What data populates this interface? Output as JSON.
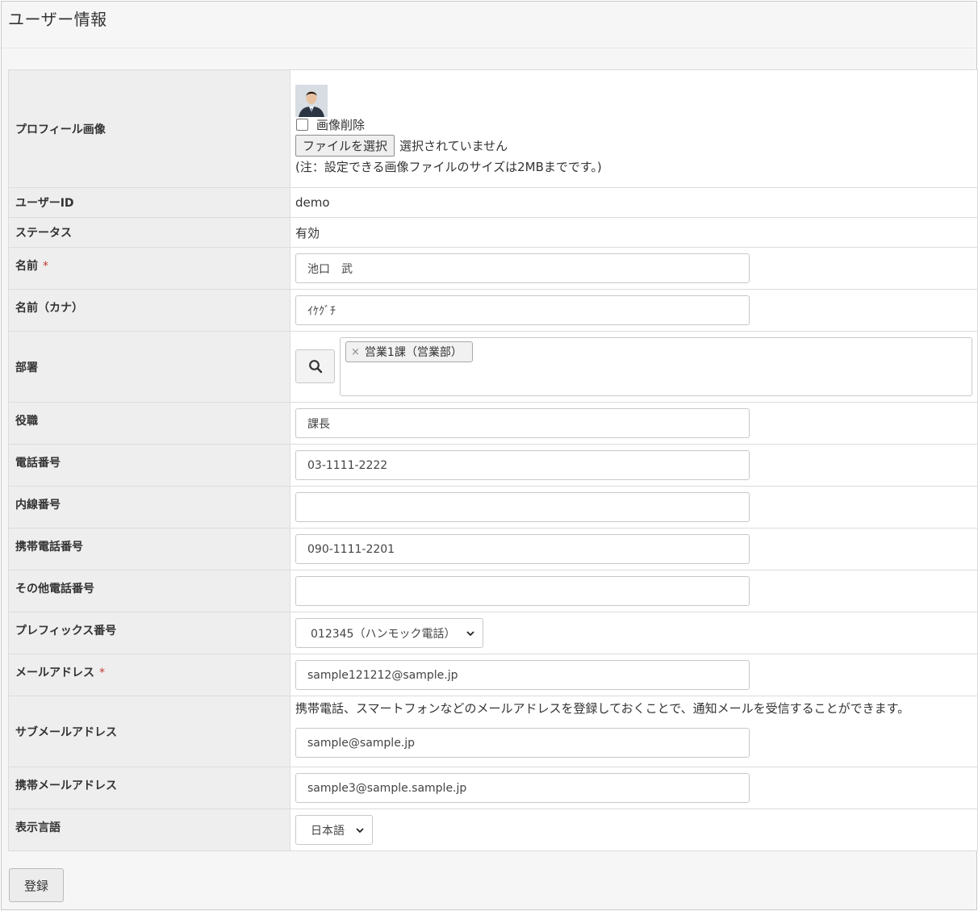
{
  "page": {
    "title": "ユーザー情報"
  },
  "profile": {
    "label": "プロフィール画像",
    "delete_label": "画像削除",
    "file_button": "ファイルを選択",
    "file_status": "選択されていません",
    "note": "(注：設定できる画像ファイルのサイズは2MBまでです。)"
  },
  "user_id": {
    "label": "ユーザーID",
    "value": "demo"
  },
  "status": {
    "label": "ステータス",
    "value": "有効"
  },
  "name": {
    "label": "名前",
    "required_mark": "*",
    "value": "池口　武"
  },
  "name_kana": {
    "label": "名前（カナ）",
    "value": "ｲｹｸﾞﾁ"
  },
  "department": {
    "label": "部署",
    "tag_remove": "×",
    "tags": [
      "営業1課（営業部）"
    ]
  },
  "position": {
    "label": "役職",
    "value": "課長"
  },
  "phone": {
    "label": "電話番号",
    "value": "03-1111-2222"
  },
  "extension": {
    "label": "内線番号",
    "value": ""
  },
  "mobile": {
    "label": "携帯電話番号",
    "value": "090-1111-2201"
  },
  "other_phone": {
    "label": "その他電話番号",
    "value": ""
  },
  "prefix": {
    "label": "プレフィックス番号",
    "selected": "012345（ハンモック電話）"
  },
  "email": {
    "label": "メールアドレス",
    "required_mark": "*",
    "value": "sample121212@sample.jp"
  },
  "sub_email": {
    "label": "サブメールアドレス",
    "help": "携帯電話、スマートフォンなどのメールアドレスを登録しておくことで、通知メールを受信することができます。",
    "value": "sample@sample.jp"
  },
  "mobile_email": {
    "label": "携帯メールアドレス",
    "value": "sample3@sample.sample.jp"
  },
  "language": {
    "label": "表示言語",
    "selected": "日本語"
  },
  "actions": {
    "submit": "登録"
  }
}
